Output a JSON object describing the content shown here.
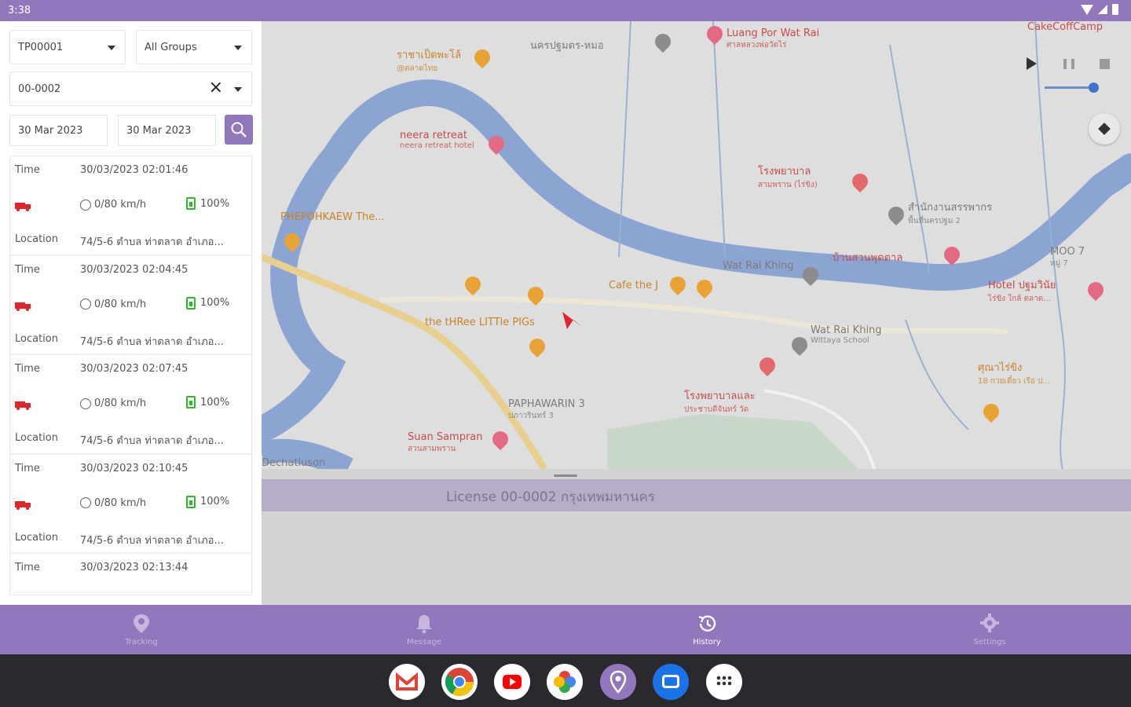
{
  "status_bar": {
    "time": "3:38"
  },
  "filters": {
    "device": "TP00001",
    "group": "All Groups",
    "vehicle": "00-0002",
    "date_from": "30 Mar 2023",
    "date_to": "30 Mar 2023"
  },
  "history": {
    "labels": {
      "time": "Time",
      "location": "Location"
    },
    "records": [
      {
        "time": "30/03/2023 02:01:46",
        "speed": "0/80 km/h",
        "battery": "100%",
        "location": "74/5-6 ตำบล ท่าตลาด อำเภอ..."
      },
      {
        "time": "30/03/2023 02:04:45",
        "speed": "0/80 km/h",
        "battery": "100%",
        "location": "74/5-6 ตำบล ท่าตลาด อำเภอ..."
      },
      {
        "time": "30/03/2023 02:07:45",
        "speed": "0/80 km/h",
        "battery": "100%",
        "location": "74/5-6 ตำบล ท่าตลาด อำเภอ..."
      },
      {
        "time": "30/03/2023 02:10:45",
        "speed": "0/80 km/h",
        "battery": "100%",
        "location": "74/5-6 ตำบล ท่าตลาด อำเภอ..."
      },
      {
        "time": "30/03/2023 02:13:44",
        "speed": "",
        "battery": "",
        "location": ""
      }
    ]
  },
  "map": {
    "places": [
      {
        "name": "Luang Por Wat Rai",
        "sub": "ศาลหลวงพ่อวัดไร่",
        "color": "r"
      },
      {
        "name": "CakeCoffCamp",
        "sub": "",
        "color": "r"
      },
      {
        "name": "ราชาเป็ดพะโล้",
        "sub": "@ตลาดไทย",
        "color": "o"
      },
      {
        "name": "นครปฐมตร-หมอ",
        "sub": "",
        "color": "g"
      },
      {
        "name": "neera retreat",
        "sub": "neera retreat hotel",
        "color": "r"
      },
      {
        "name": "โรงพยาบาล",
        "sub": "สามพราน (ไร่ขิง)",
        "color": "r"
      },
      {
        "name": "สำนักงานสรรพากร",
        "sub": "พื้นที่นครปฐม 2",
        "color": "g"
      },
      {
        "name": "PHEPOHKAEW The...",
        "sub": "",
        "color": "o"
      },
      {
        "name": "บ้านสวนพุดตาล",
        "sub": "",
        "color": "r"
      },
      {
        "name": "MOO 7",
        "sub": "หมู่ 7",
        "color": "g"
      },
      {
        "name": "Wat Rai Khing",
        "sub": "",
        "color": "g"
      },
      {
        "name": "Cafe the J",
        "sub": "",
        "color": "o"
      },
      {
        "name": "Hotel ปฐมวินัย",
        "sub": "ไร่ขิง ใกล้ ตลาด...",
        "color": "r"
      },
      {
        "name": "the tHRee LITTle PIGs",
        "sub": "",
        "color": "o"
      },
      {
        "name": "Wat Rai Khing",
        "sub": "Wittaya School",
        "color": "g"
      },
      {
        "name": "PAPHAWARIN 3",
        "sub": "ปภาวรินทร์ 3",
        "color": "g"
      },
      {
        "name": "ศุณาไร่ขิง",
        "sub": "18 กวยเตี๋ยว เรือ ป...",
        "color": "o"
      },
      {
        "name": "Suan Sampran",
        "sub": "สวนสามพราน",
        "color": "r"
      },
      {
        "name": "Dechatiuson",
        "sub": "",
        "color": "g"
      },
      {
        "name": "โรงพยาบาลและ",
        "sub": "ประชาบดีจันทร์ วัด",
        "color": "r"
      }
    ]
  },
  "bottom_sheet": {
    "license": "License 00-0002 กรุงเทพมหานคร"
  },
  "nav": {
    "tracking": "Tracking",
    "message": "Message",
    "history": "History",
    "settings": "Settings"
  },
  "colors": {
    "accent": "#9277bd",
    "battery_ok": "#2db82d",
    "vehicle_marker": "#e0262b"
  }
}
